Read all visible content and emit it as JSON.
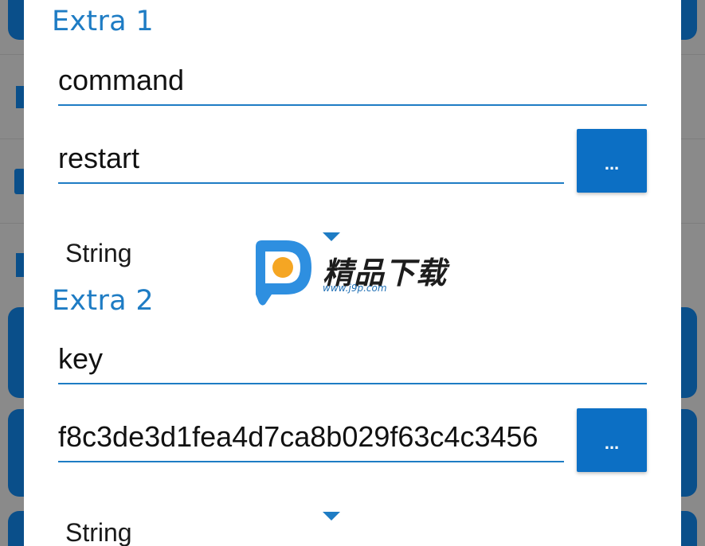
{
  "extras": [
    {
      "title": "Extra 1",
      "key": "command",
      "value": "restart",
      "type": "String",
      "browse_label": "..."
    },
    {
      "title": "Extra 2",
      "key": "key",
      "value": "f8c3de3d1fea4d7ca8b029f63c4c3456",
      "type": "String",
      "browse_label": "..."
    }
  ],
  "watermark": {
    "text": "精品下载",
    "url": "www.j9p.com"
  },
  "colors": {
    "accent": "#1e7cc4",
    "button": "#0c6fc4",
    "dimmed_background": "#8a8a8a",
    "dialog": "#ffffff"
  }
}
